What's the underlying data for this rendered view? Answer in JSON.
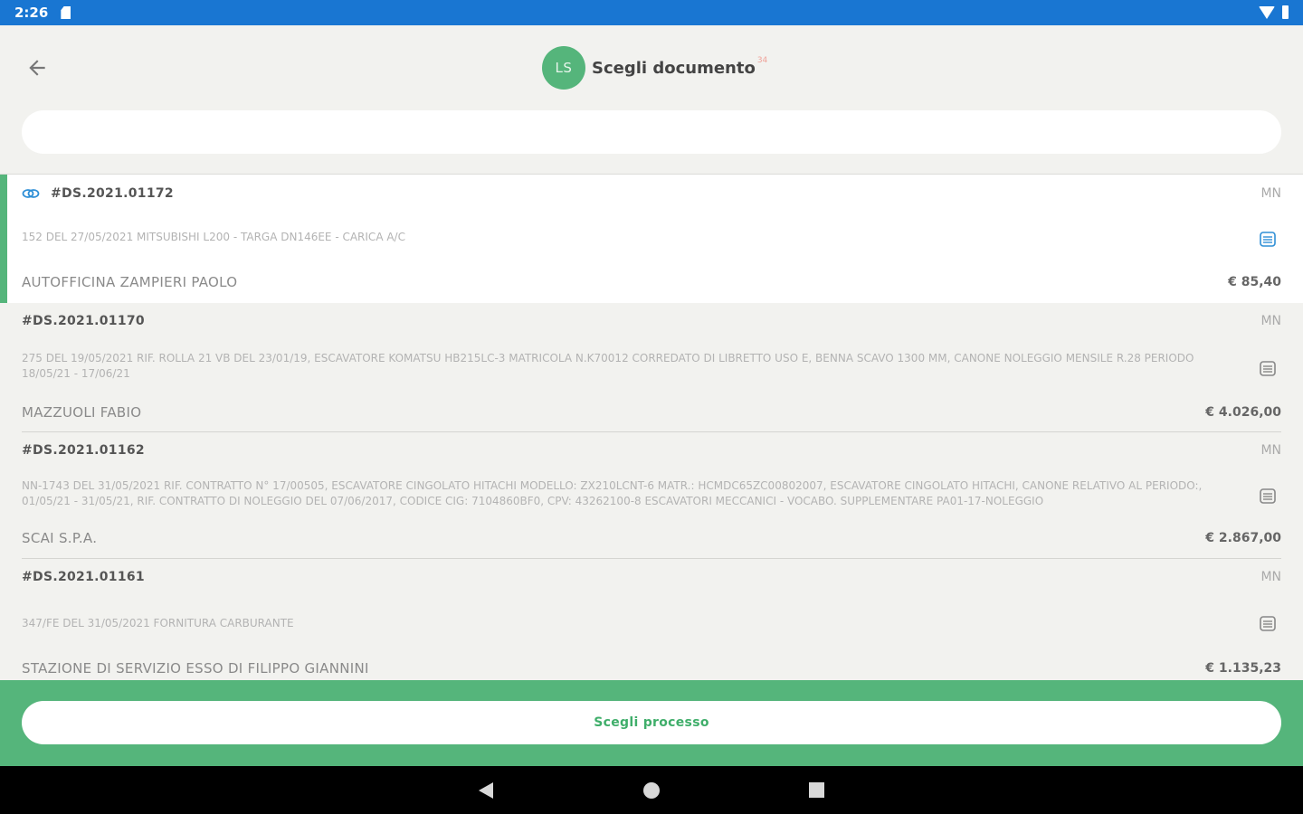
{
  "status_bar": {
    "time": "2:26"
  },
  "header": {
    "avatar_initials": "LS",
    "title": "Scegli documento",
    "count": "34"
  },
  "search": {
    "value": "",
    "placeholder": ""
  },
  "documents": [
    {
      "number": "#DS.2021.01172",
      "code": "MN",
      "description": "152 del 27/05/2021 MITSUBISHI L200 - TARGA DN146EE - CARICA A/C",
      "supplier": "AUTOFFICINA ZAMPIERI PAOLO",
      "amount": "€ 85,40"
    },
    {
      "number": "#DS.2021.01170",
      "code": "MN",
      "description": "275 del 19/05/2021 RIF. ROLLA        21 VB DEL 23/01/19, ESCAVATORE KOMATSU HB215LC-3 MATRICOLA N.K70012 CORREDATO DI LIBRETTO USO E, BENNA SCAVO 1300 MM, CANONE NOLEGGIO MENSILE R.28 PERIODO 18/05/21 - 17/06/21",
      "supplier": "MAZZUOLI FABIO",
      "amount": "€ 4.026,00"
    },
    {
      "number": "#DS.2021.01162",
      "code": "MN",
      "description": "NN-1743 del 31/05/2021 Rif. CONTRATTO N° 17/00505, ESCAVATORE CINGOLATO HITACHI    Modello:  ZX210LCNT-6  Matr.:  HCMDC65ZC00802007, ESCAVATORE CINGOLATO HITACHI, CANONE RELATIVO AL PERIODO:, 01/05/21 - 31/05/21, RIF. CONTRATTO DI NOLEGGIO DEL 07/06/2017, CODICE CIG: 7104860BF0, CPV: 43262100-8 ESCAVATORI MECCANICI - VOCABO. SUPPLEMENTARE PA01-17-NOLEGGIO",
      "supplier": "SCAI S.P.A.",
      "amount": "€ 2.867,00"
    },
    {
      "number": "#DS.2021.01161",
      "code": "MN",
      "description": "347/FE del 31/05/2021 FORNITURA CARBURANTE",
      "supplier": "STAZIONE DI SERVIZIO ESSO DI FILIPPO GIANNINI",
      "amount": "€ 1.135,23"
    }
  ],
  "action": {
    "choose_process_label": "Scegli processo"
  },
  "colors": {
    "status_bar": "#1976d2",
    "accent_green": "#55b57b",
    "link_blue": "#2f8fd6",
    "background": "#f2f2ef"
  }
}
